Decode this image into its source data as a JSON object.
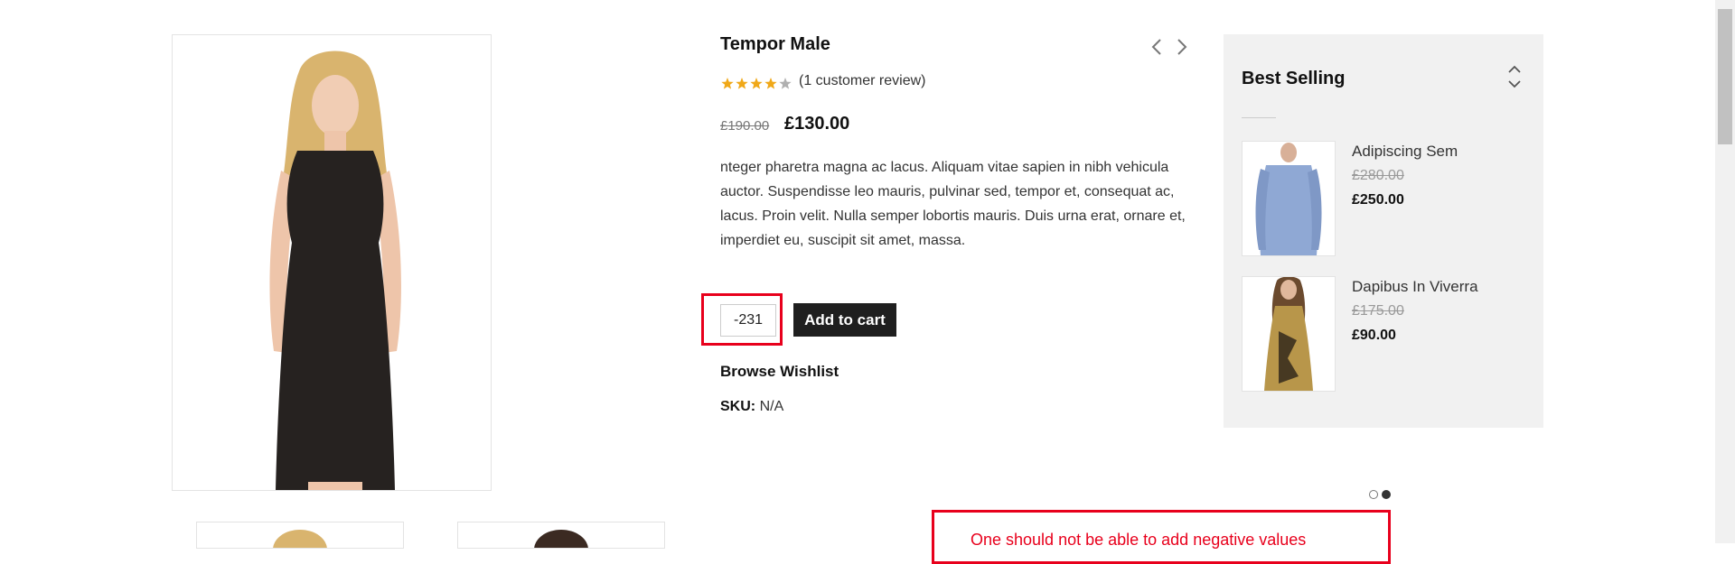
{
  "product": {
    "title": "Tempor Male",
    "review_text": "(1 customer review)",
    "rating": 4,
    "rating_max": 5,
    "old_price": "£190.00",
    "new_price": "£130.00",
    "description": "nteger pharetra magna ac lacus. Aliquam vitae sapien in nibh vehicula auctor. Suspendisse leo mauris, pulvinar sed, tempor et, consequat ac, lacus. Proin velit. Nulla semper lobortis mauris. Duis urna erat, ornare et, imperdiet eu, suscipit sit amet, massa.",
    "quantity_value": "-231",
    "add_to_cart_label": "Add to cart",
    "wishlist_label": "Browse Wishlist",
    "sku_label": "SKU:",
    "sku_value": "N/A"
  },
  "sidebar": {
    "title": "Best Selling",
    "items": [
      {
        "name": "Adipiscing Sem",
        "old_price": "£280.00",
        "new_price": "£250.00"
      },
      {
        "name": "Dapibus In Viverra",
        "old_price": "£175.00",
        "new_price": "£90.00"
      }
    ]
  },
  "slider": {
    "pages": 2,
    "active_page": 2
  },
  "annotation": {
    "text": "One should not be able to add negative values",
    "color": "#e8001c"
  },
  "colors": {
    "star": "#f0a818",
    "button_bg": "#1f1f1f",
    "sidebar_bg": "#f1f1f1"
  },
  "icons": [
    "chevron-left-icon",
    "chevron-right-icon",
    "chevron-up-icon",
    "chevron-down-icon",
    "star-icon"
  ]
}
